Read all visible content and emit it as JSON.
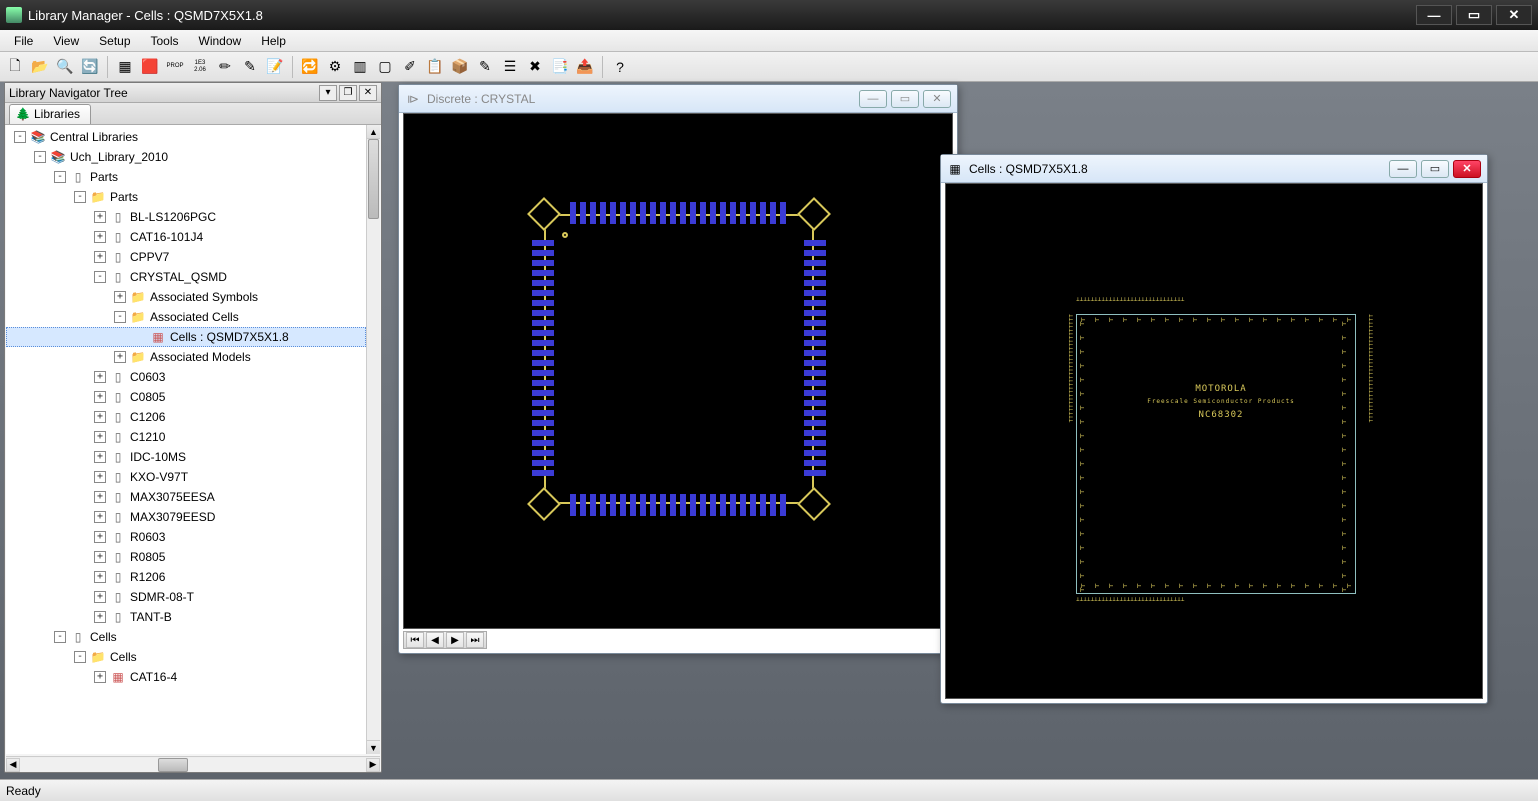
{
  "title": "Library Manager - Cells : QSMD7X5X1.8",
  "menus": [
    "File",
    "View",
    "Setup",
    "Tools",
    "Window",
    "Help"
  ],
  "toolbar_icons": [
    {
      "name": "new-file-icon",
      "glyph": "🗋"
    },
    {
      "name": "open-file-icon",
      "glyph": "📂"
    },
    {
      "name": "find-icon",
      "glyph": "🔍"
    },
    {
      "name": "refresh-icon",
      "glyph": "🔄"
    },
    {
      "sep": true
    },
    {
      "name": "grid-icon",
      "glyph": "▦"
    },
    {
      "name": "color-swatches-icon",
      "glyph": "🟥"
    },
    {
      "name": "properties-icon",
      "glyph": "PROP",
      "small": true
    },
    {
      "name": "units-icon",
      "glyph": "1E3\n2.06",
      "small": true
    },
    {
      "name": "edit-part-icon",
      "glyph": "✏"
    },
    {
      "name": "edit-symbol-icon",
      "glyph": "✎"
    },
    {
      "name": "edit-cell-icon",
      "glyph": "📝"
    },
    {
      "sep": true
    },
    {
      "name": "sync-icon",
      "glyph": "🔁"
    },
    {
      "name": "compile-icon",
      "glyph": "⚙"
    },
    {
      "name": "chip-icon",
      "glyph": "▥"
    },
    {
      "name": "blank-icon",
      "glyph": "▢"
    },
    {
      "name": "edit-cell2-icon",
      "glyph": "✐"
    },
    {
      "name": "clipboard-icon",
      "glyph": "📋"
    },
    {
      "name": "package-icon",
      "glyph": "📦"
    },
    {
      "name": "edit3-icon",
      "glyph": "✎"
    },
    {
      "name": "layers-icon",
      "glyph": "☰"
    },
    {
      "name": "delete-icon",
      "glyph": "✖"
    },
    {
      "name": "copy-part-icon",
      "glyph": "📑"
    },
    {
      "name": "move-part-icon",
      "glyph": "📤"
    },
    {
      "sep": true
    },
    {
      "name": "help-icon",
      "glyph": "?"
    }
  ],
  "nav": {
    "header": "Library Navigator Tree",
    "tab": "Libraries",
    "tree": [
      {
        "d": 0,
        "e": "-",
        "i": "lib",
        "t": "Central Libraries"
      },
      {
        "d": 1,
        "e": "-",
        "i": "lib",
        "t": "Uch_Library_2010"
      },
      {
        "d": 2,
        "e": "-",
        "i": "part",
        "t": "Parts"
      },
      {
        "d": 3,
        "e": "-",
        "i": "folder",
        "t": "Parts"
      },
      {
        "d": 4,
        "e": "+",
        "i": "part",
        "t": "BL-LS1206PGC"
      },
      {
        "d": 4,
        "e": "+",
        "i": "part",
        "t": "CAT16-101J4"
      },
      {
        "d": 4,
        "e": "+",
        "i": "part",
        "t": "CPPV7"
      },
      {
        "d": 4,
        "e": "-",
        "i": "part",
        "t": "CRYSTAL_QSMD"
      },
      {
        "d": 5,
        "e": "+",
        "i": "assoc",
        "t": "Associated Symbols"
      },
      {
        "d": 5,
        "e": "-",
        "i": "assoc",
        "t": "Associated Cells"
      },
      {
        "d": 6,
        "e": " ",
        "i": "cell",
        "t": "Cells : QSMD7X5X1.8",
        "sel": true
      },
      {
        "d": 5,
        "e": "+",
        "i": "assoc",
        "t": "Associated Models"
      },
      {
        "d": 4,
        "e": "+",
        "i": "part",
        "t": "C0603"
      },
      {
        "d": 4,
        "e": "+",
        "i": "part",
        "t": "C0805"
      },
      {
        "d": 4,
        "e": "+",
        "i": "part",
        "t": "C1206"
      },
      {
        "d": 4,
        "e": "+",
        "i": "part",
        "t": "C1210"
      },
      {
        "d": 4,
        "e": "+",
        "i": "part",
        "t": "IDC-10MS"
      },
      {
        "d": 4,
        "e": "+",
        "i": "part",
        "t": "KXO-V97T"
      },
      {
        "d": 4,
        "e": "+",
        "i": "part",
        "t": "MAX3075EESA"
      },
      {
        "d": 4,
        "e": "+",
        "i": "part",
        "t": "MAX3079EESD"
      },
      {
        "d": 4,
        "e": "+",
        "i": "part",
        "t": "R0603"
      },
      {
        "d": 4,
        "e": "+",
        "i": "part",
        "t": "R0805"
      },
      {
        "d": 4,
        "e": "+",
        "i": "part",
        "t": "R1206"
      },
      {
        "d": 4,
        "e": "+",
        "i": "part",
        "t": "SDMR-08-T"
      },
      {
        "d": 4,
        "e": "+",
        "i": "part",
        "t": "TANT-B"
      },
      {
        "d": 2,
        "e": "-",
        "i": "part",
        "t": "Cells"
      },
      {
        "d": 3,
        "e": "-",
        "i": "folder",
        "t": "Cells"
      },
      {
        "d": 4,
        "e": "+",
        "i": "cell",
        "t": "CAT16-4"
      }
    ]
  },
  "win_discrete": {
    "title": "Discrete : CRYSTAL"
  },
  "win_cells": {
    "title": "Cells : QSMD7X5X1.8",
    "chip_vendor": "MOTOROLA",
    "chip_sub": "Freescale Semiconductor Products",
    "chip_part": "NC68302"
  },
  "status": "Ready"
}
